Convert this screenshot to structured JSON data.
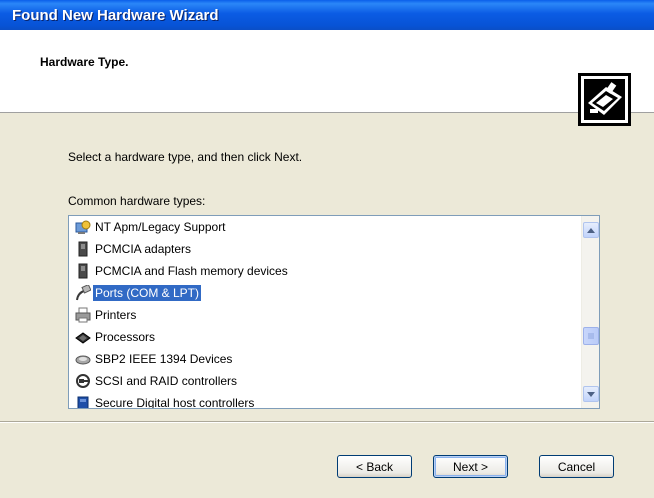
{
  "window": {
    "title": "Found New Hardware Wizard"
  },
  "header": {
    "title": "Hardware Type.",
    "icon": "hardware-wizard-icon"
  },
  "content": {
    "instruction": "Select a hardware type, and then click Next.",
    "list_label": "Common hardware types:",
    "items": [
      {
        "label": "NT Apm/Legacy Support",
        "icon": "power-management-icon"
      },
      {
        "label": "PCMCIA adapters",
        "icon": "pcmcia-card-icon"
      },
      {
        "label": "PCMCIA and Flash memory devices",
        "icon": "pcmcia-card-icon"
      },
      {
        "label": "Ports (COM & LPT)",
        "icon": "port-connector-icon",
        "selected": true
      },
      {
        "label": "Printers",
        "icon": "printer-icon"
      },
      {
        "label": "Processors",
        "icon": "processor-icon"
      },
      {
        "label": "SBP2 IEEE 1394 Devices",
        "icon": "firewire-icon"
      },
      {
        "label": "SCSI and RAID controllers",
        "icon": "scsi-icon"
      },
      {
        "label": "Secure Digital host controllers",
        "icon": "sd-controller-icon"
      }
    ]
  },
  "buttons": {
    "back": "< Back",
    "next": "Next >",
    "cancel": "Cancel"
  },
  "colors": {
    "titlebar": "#0A5FEA",
    "selection": "#316AC5",
    "dialog_bg": "#ECE9D8"
  }
}
